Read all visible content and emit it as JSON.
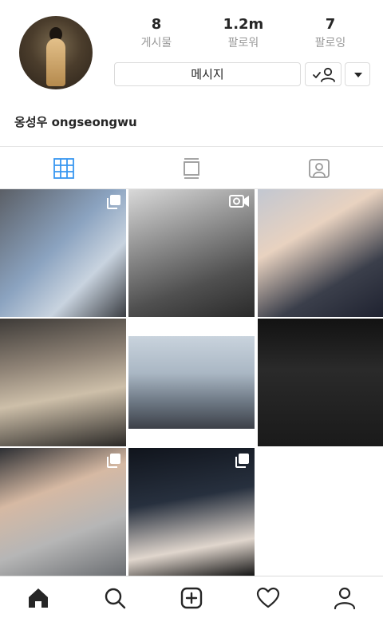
{
  "profile": {
    "username": "옹성우 ongseongwu",
    "stats": [
      {
        "value": "8",
        "label": "게시물"
      },
      {
        "value": "1.2m",
        "label": "팔로워"
      },
      {
        "value": "7",
        "label": "팔로잉"
      }
    ],
    "message_label": "메시지"
  },
  "tabs": [
    {
      "icon": "grid-icon",
      "active": true
    },
    {
      "icon": "feed-icon",
      "active": false
    },
    {
      "icon": "tagged-icon",
      "active": false
    }
  ],
  "posts": [
    {
      "icon": "multiple-photos-icon"
    },
    {
      "icon": "video-icon"
    },
    {
      "icon": ""
    },
    {
      "icon": ""
    },
    {
      "icon": ""
    },
    {
      "icon": ""
    },
    {
      "icon": "multiple-photos-icon"
    },
    {
      "icon": "multiple-photos-icon"
    }
  ],
  "bottom_nav": [
    "home-icon",
    "search-icon",
    "new-post-icon",
    "activity-icon",
    "profile-icon"
  ],
  "colors": {
    "active_tab": "#3897f0",
    "text": "#262626",
    "muted": "#999999",
    "border": "#dbdbdb"
  }
}
